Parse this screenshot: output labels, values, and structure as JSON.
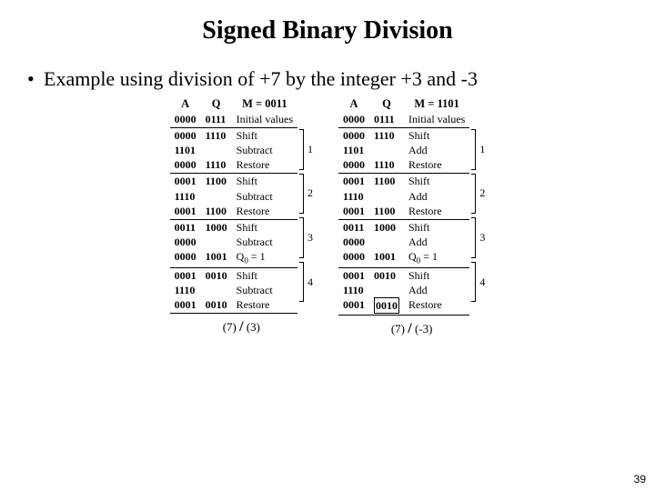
{
  "title": "Signed Binary Division",
  "bullet": "Example using division of +7 by the integer +3 and -3",
  "page_number": "39",
  "left": {
    "headers": {
      "a": "A",
      "q": "Q",
      "m": "M = 0011"
    },
    "initial": {
      "a": "0000",
      "q": "0111",
      "label": "Initial values"
    },
    "steps": [
      {
        "rows": [
          {
            "a": "0000",
            "q": "1110",
            "op": "Shift"
          },
          {
            "a": "1101",
            "q": "",
            "op": "Subtract"
          },
          {
            "a": "0000",
            "q": "1110",
            "op": "Restore"
          }
        ],
        "num": "1"
      },
      {
        "rows": [
          {
            "a": "0001",
            "q": "1100",
            "op": "Shift"
          },
          {
            "a": "1110",
            "q": "",
            "op": "Subtract"
          },
          {
            "a": "0001",
            "q": "1100",
            "op": "Restore"
          }
        ],
        "num": "2"
      },
      {
        "rows": [
          {
            "a": "0011",
            "q": "1000",
            "op": "Shift"
          },
          {
            "a": "0000",
            "q": "",
            "op": "Subtract"
          },
          {
            "a": "0000",
            "q": "1001",
            "op": "Q0 = 1",
            "q0": true
          }
        ],
        "num": "3"
      },
      {
        "rows": [
          {
            "a": "0001",
            "q": "0010",
            "op": "Shift"
          },
          {
            "a": "1110",
            "q": "",
            "op": "Subtract"
          },
          {
            "a": "0001",
            "q": "0010",
            "op": "Restore"
          }
        ],
        "num": "4"
      }
    ],
    "caption_left": "(7)",
    "caption_mid": "/",
    "caption_right": "(3)"
  },
  "right": {
    "headers": {
      "a": "A",
      "q": "Q",
      "m": "M = 1101"
    },
    "initial": {
      "a": "0000",
      "q": "0111",
      "label": "Initial values"
    },
    "steps": [
      {
        "rows": [
          {
            "a": "0000",
            "q": "1110",
            "op": "Shift"
          },
          {
            "a": "1101",
            "q": "",
            "op": "Add"
          },
          {
            "a": "0000",
            "q": "1110",
            "op": "Restore"
          }
        ],
        "num": "1"
      },
      {
        "rows": [
          {
            "a": "0001",
            "q": "1100",
            "op": "Shift"
          },
          {
            "a": "1110",
            "q": "",
            "op": "Add"
          },
          {
            "a": "0001",
            "q": "1100",
            "op": "Restore"
          }
        ],
        "num": "2"
      },
      {
        "rows": [
          {
            "a": "0011",
            "q": "1000",
            "op": "Shift"
          },
          {
            "a": "0000",
            "q": "",
            "op": "Add"
          },
          {
            "a": "0000",
            "q": "1001",
            "op": "Q0 = 1",
            "q0": true
          }
        ],
        "num": "3"
      },
      {
        "rows": [
          {
            "a": "0001",
            "q": "0010",
            "op": "Shift"
          },
          {
            "a": "1110",
            "q": "",
            "op": "Add"
          },
          {
            "a": "0001",
            "q": "0010",
            "op": "Restore",
            "boxq": true
          }
        ],
        "num": "4"
      }
    ],
    "caption_left": "(7)",
    "caption_mid": "/",
    "caption_right": "(-3)"
  }
}
